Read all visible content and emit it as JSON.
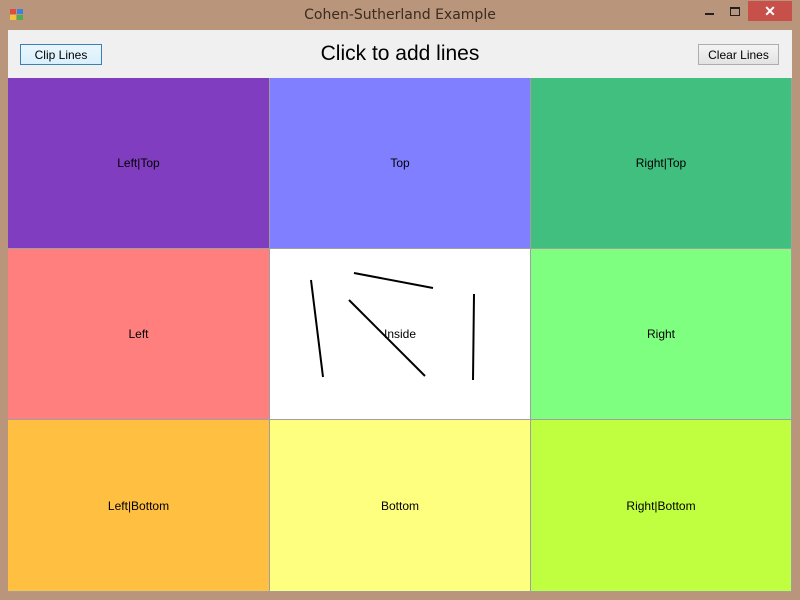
{
  "window": {
    "title": "Cohen-Sutherland Example",
    "close_glyph": "✕",
    "icon": "app-icon"
  },
  "toolbar": {
    "clip_label": "Clip Lines",
    "clear_label": "Clear Lines",
    "title": "Click to add lines"
  },
  "colors": {
    "left_top": "#803dbf",
    "top": "#7f7fff",
    "right_top": "#40bf7f",
    "left": "#ff7f7f",
    "inside": "#ffffff",
    "right": "#7fff7f",
    "left_bottom": "#ffbf40",
    "bottom": "#ffff7f",
    "right_bottom": "#bfff40",
    "line": "#000000"
  },
  "regions": [
    {
      "label": "Left|Top",
      "color_key": "left_top"
    },
    {
      "label": "Top",
      "color_key": "top"
    },
    {
      "label": "Right|Top",
      "color_key": "right_top"
    },
    {
      "label": "Left",
      "color_key": "left"
    },
    {
      "label": "Inside",
      "color_key": "inside"
    },
    {
      "label": "Right",
      "color_key": "right"
    },
    {
      "label": "Left|Bottom",
      "color_key": "left_bottom"
    },
    {
      "label": "Bottom",
      "color_key": "bottom"
    },
    {
      "label": "Right|Bottom",
      "color_key": "right_bottom"
    }
  ]
}
